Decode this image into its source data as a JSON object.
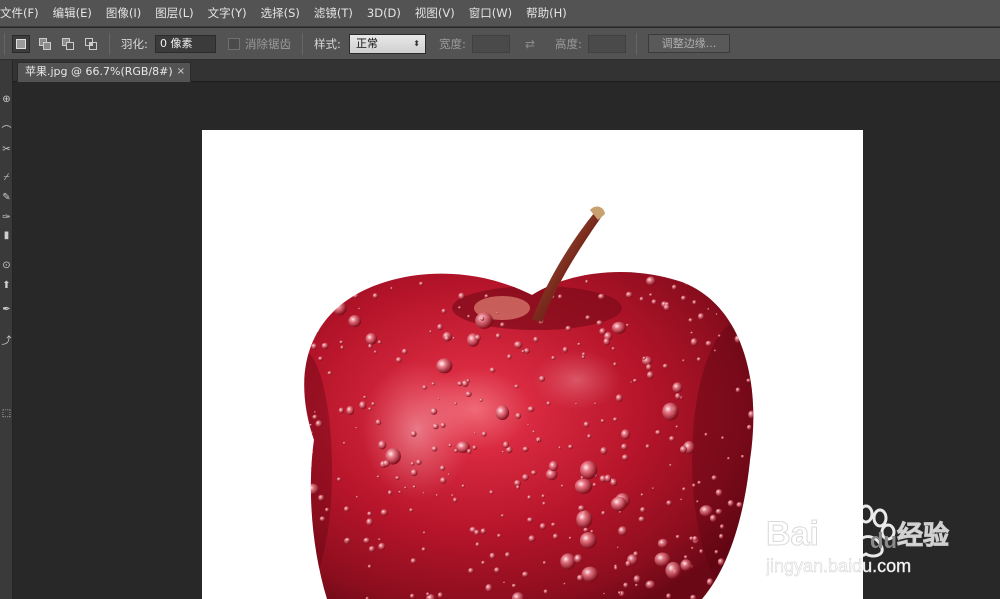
{
  "menu": [
    "文件(F)",
    "编辑(E)",
    "图像(I)",
    "图层(L)",
    "文字(Y)",
    "选择(S)",
    "滤镜(T)",
    "3D(D)",
    "视图(V)",
    "窗口(W)",
    "帮助(H)"
  ],
  "options": {
    "feather_label": "羽化:",
    "feather_value": "0 像素",
    "antialias_label": "消除锯齿",
    "style_label": "样式:",
    "style_value": "正常",
    "width_label": "宽度:",
    "height_label": "高度:",
    "refine_edge_label": "调整边缘..."
  },
  "document": {
    "tab_title": "苹果.jpg @ 66.7%(RGB/8#)",
    "close_glyph": "×"
  },
  "tools": [
    "⊕",
    "⌒",
    "✂",
    "⌿",
    "✎",
    "✑",
    "▮",
    "⊙",
    "⬆",
    "✒",
    "⤴",
    "⬚"
  ],
  "watermark": {
    "brand": "Bai",
    "brand_cn": "经验",
    "url": "jingyan.baidu.com"
  },
  "colors": {
    "menubar": "#535353",
    "workspace": "#282828",
    "apple_red": "#b5142a"
  }
}
